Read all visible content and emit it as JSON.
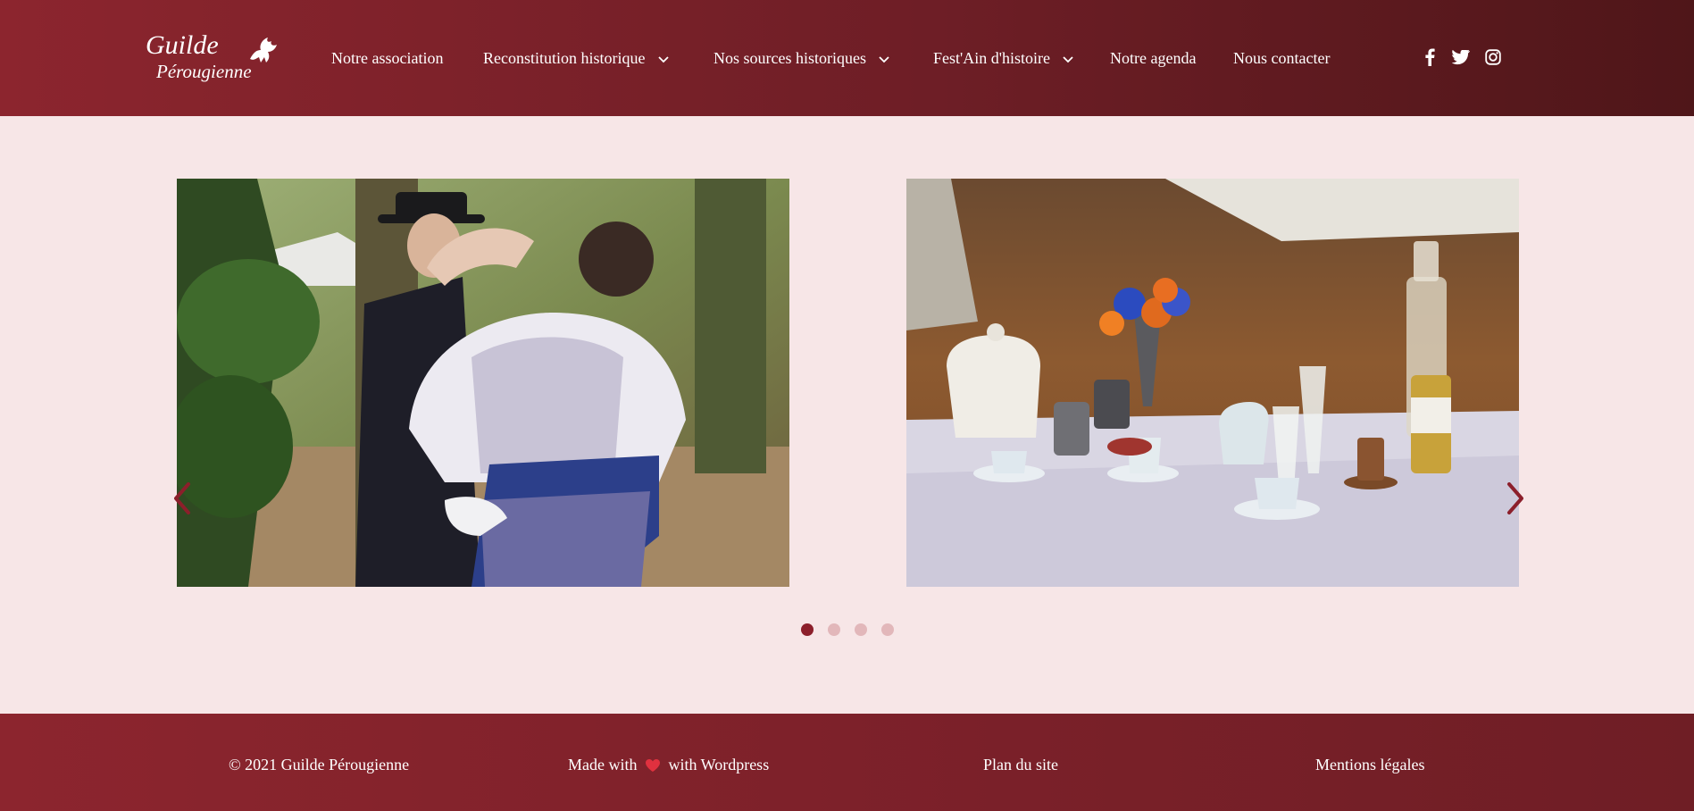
{
  "header": {
    "logo": {
      "line1": "Guilde",
      "line2": "Pérougienne"
    },
    "nav": [
      {
        "label": "Notre association",
        "has_dropdown": false
      },
      {
        "label": "Reconstitution historique",
        "has_dropdown": true
      },
      {
        "label": "Nos sources historiques",
        "has_dropdown": true
      },
      {
        "label": "Fest'Ain d'histoire",
        "has_dropdown": true
      },
      {
        "label": "Notre agenda",
        "has_dropdown": false
      },
      {
        "label": "Nous contacter",
        "has_dropdown": false
      }
    ],
    "social_icons": [
      "facebook-icon",
      "twitter-icon",
      "instagram-icon"
    ]
  },
  "slider": {
    "slides": [
      "couple-in-period-costume-photo",
      "tea-table-setting-photo"
    ],
    "dots_count": 4,
    "active_dot": 1
  },
  "footer": {
    "copyright": "© 2021 Guilde Pérougienne",
    "made_with_prefix": "Made with",
    "made_with_suffix": "with Wordpress",
    "sitemap": "Plan du site",
    "legal": "Mentions légales"
  },
  "colors": {
    "header_bg": "#8c252e",
    "page_bg": "#f7e6e7",
    "accent": "#8c1f2b",
    "heart": "#e0313f"
  }
}
